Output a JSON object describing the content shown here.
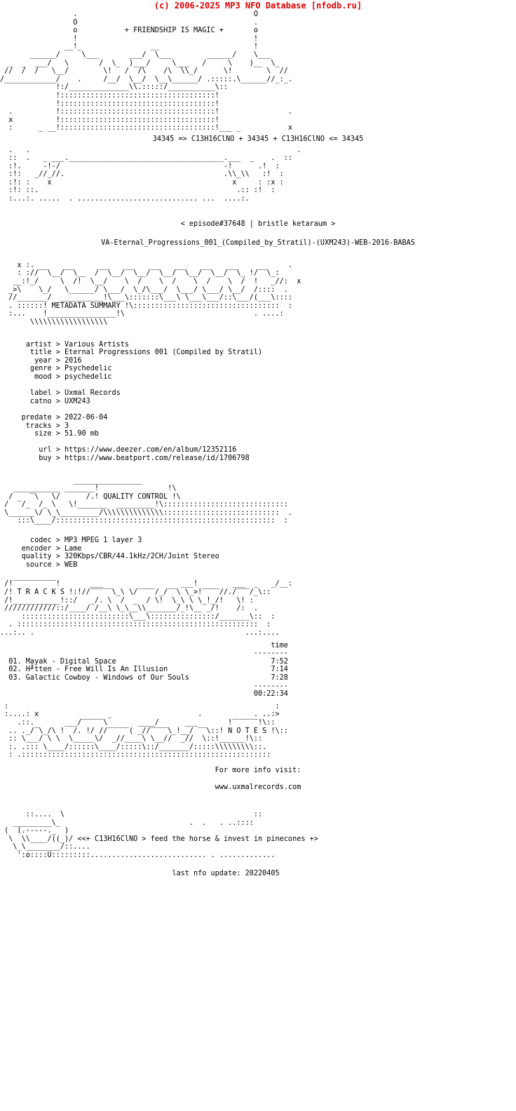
{
  "header": {
    "copyright": "(c) 2006-2025 MP3 NFO Database [nfodb.ru]",
    "copyright_color": "#dd0000"
  },
  "banner": {
    "tagline": "+ FRIENDSHIP IS MAGIC +",
    "formula_line": "34345 => C13H16ClNO + 34345 + C13H16ClNO <= 34345",
    "episode_line": "< episode#37648 | bristle ketaraum >",
    "release_name": "VA-Eternal_Progressions_001_(Compiled_by_Stratil)-(UXM243)-WEB-2016-BABAS",
    "art_top": [
      "                 .                                         O",
      "                 O                                         .",
      "                 o           + FRIENDSHIP IS MAGIC +       o",
      "                 !                                         !",
      "               __!_                __                      !",
      "       ______/     \\___       ___/  \\___        ______/    \\___",
      "  _  _  ___/   \\       /  \\_  )___/     \\___   /     \\    )__  \\_",
      " //  /  /   \\__/        \\!   /  /\\    /\\  \\\\_/      \\!        \\  //",
      "/____________/    .     /__/  \\__/  \\__\\______/ .:::::.\\______//_:_.",
      "             !:/______________\\\\.:::::/___________\\::                ",
      "             !::::::::::::::::::::::::::::::::::::!                  ",
      "             !::::::::::::::::::::::::::::::::::::!                  ",
      "  .          !::::::::::::::::::::::::::::::::::::!                .",
      "  x          !::::::::::::::::::::::::::::::::::::!                  ",
      "  :      _ __!::::::::::::::::::::::::::::::::::::!___ _           x"
    ],
    "art_bottom": [
      "  .   .                                                              .",
      "  ::  .   _ ___.____________________________________.___  _    .  ::",
      "  :!.     -!-/                                      -!      .!  :",
      "  :!:   _//_//.                                     .\\\\_\\\\   :!  :",
      "  :!: :    x                                          x     : :x :",
      "  :!: ::.                                              .:: :!  :",
      "  :...:. .....  . ............................ ...  ....:."
    ]
  },
  "sections": {
    "metadata": {
      "label": "METADATA SUMMARY",
      "art": [
        "    x :.                                                           .",
        "    : ://‾‾\\__/‾‾\\__  /‾‾\\__/‾‾\\__/‾‾\\__/‾‾\\__/‾‾\\__/‾‾\\_ !/‾‾\\_:",
        "   __:!_/     \\  /!  \\__/    \\  /    \\  /    \\  /    \\  /  !   _//:  x",
        "  _>\\    \\_/   \\______/ \\___/  \\_/\\___/  \\___/ \\___/ \\__/  /::::  .",
        "  //_______/  __________!\\___\\:::::::\\___\\ \\___\\___/::\\___/(___\\::::",
        "  . ::::::! METADATA SUMMARY !\\::::::::::::::::::::::::::::::::::  :",
        "  :...    !________________!\\                              . ....:",
        "       \\\\\\\\\\\\\\\\\\\\\\\\\\\\\\\\\\\\"
      ],
      "fields": [
        {
          "key": "artist",
          "value": "Various Artists"
        },
        {
          "key": "title",
          "value": "Eternal Progressions 001 (Compiled by Stratil)"
        },
        {
          "key": "year",
          "value": "2016"
        },
        {
          "key": "genre",
          "value": "Psychedelic"
        },
        {
          "key": "mood",
          "value": "psychedelic"
        }
      ],
      "fields2": [
        {
          "key": "label",
          "value": "Uxmal Records"
        },
        {
          "key": "catno",
          "value": "UXM243"
        }
      ],
      "fields3": [
        {
          "key": "predate",
          "value": "2022-06-04"
        },
        {
          "key": "tracks",
          "value": "3"
        },
        {
          "key": "size",
          "value": "51.90 mb"
        }
      ],
      "fields4": [
        {
          "key": "url",
          "value": "https://www.deezer.com/en/album/12352116"
        },
        {
          "key": "buy",
          "value": "https://www.beatport.com/release/id/1706798"
        }
      ]
    },
    "quality": {
      "label": "QUALITY CONTROL",
      "art": [
        "                 ________________",
        "   ___________ _______!                !\\",
        "  /    ‾\\   \\/      /.! QUALITY CONTROL !\\",
        " /  ‾/_  /_ \\   \\!_______  _________!\\:::::::::::::::::::::::::::::",
        " \\______\\/ \\_\\_________/\\\\\\\\\\\\\\\\\\\\\\\\\\\\:::::::::::::::::::::::::::  .",
        "    :::\\____/:::::::::::::::::::::::::::::::::::::::::::::::::::  :"
      ],
      "fields": [
        {
          "key": "codec",
          "value": "MP3 MPEG 1 layer 3"
        },
        {
          "key": "encoder",
          "value": "Lame"
        },
        {
          "key": "quality",
          "value": "320Kbps/CBR/44.1kHz/2CH/Joint Stereo"
        },
        {
          "key": "source",
          "value": "WEB"
        }
      ]
    },
    "tracks": {
      "label": "TRACKS",
      "art": [
        " /!‾‾‾‾‾‾‾‾‾‾!       ___                  ___!        ___  _   _/__:",
        " /! T R A C K S !:!//‾‾‾‾‾\\_\\ \\/‾‾‾‾/_/‾‾\\ \\_>!‾‾‾‾//./‾‾‾/_\\::",
        " /!___________!::/   _/. \\  /  _  / \\!  \\_\\ \\ \\_!_/!   \\! :",
        " ////////////::/____/ /__\\ \\_\\__\\\\_______/_!\\__ _/!    /:  .",
        "     :::::::::::::::::::::::::\\___\\:::::::::::::::/_______\\::  :",
        "  . ::::::::::::::::::::::::::::::::::::::::::::::::::::::::  :",
        "...:.. .                                                 ...:...."
      ],
      "time_header": "time",
      "time_rule": "--------",
      "items": [
        {
          "num": "01.",
          "name": "Mayak - Digital Space",
          "time": "7:52"
        },
        {
          "num": "02.",
          "name": "H╜tten - Free Will Is An Illusion",
          "time": "7:14"
        },
        {
          "num": "03.",
          "name": "Galactic Cowboy - Windows of Our Souls",
          "time": "7:28"
        }
      ],
      "total": "00:22:34"
    },
    "notes": {
      "label": "NOTES",
      "art": [
        " :                                                              :",
        " :....: x                _                    .            . ..:>",
        "    .::.       ___/‾‾‾‾‾\\       ____/      ___       !‾‾‾‾‾‾!\\::",
        "  .. ._/‾\\_/\\ !  /. !/ //‾‾‾‾‾( _//‾‾‾‾\\_!__/ ‾‾\\::! N O T E S !\\::",
        "  :: \\___/ \\ \\  \\_____\\/  _//____\\ \\__//  _//  \\::!______!\\::",
        "  :. .::: \\____/::::::\\____/:::::\\::/_______/:::::\\\\\\\\\\\\\\\\\\::.",
        "  : .::::::::::::::::::::::::::::::::::::::::::::::::::::::::::"
      ],
      "info_line": "For more info visit:",
      "website": "www.uxmalrecords.com"
    }
  },
  "footer": {
    "art": [
      "      ::....  \\                                            ::",
      "   _________\\_                              .  .   . ..::::",
      " (  (.-----._  )",
      "  \\  \\\\____/((_)/ ",
      "   \\_\\________/::....",
      "    ':o::::U:::::::::........................... . ............."
    ],
    "tagline": "<<+ C13H16ClNO > feed the horse & invest in pinecones +>",
    "last_update_label": "last nfo update:",
    "last_update_value": "20220405"
  }
}
